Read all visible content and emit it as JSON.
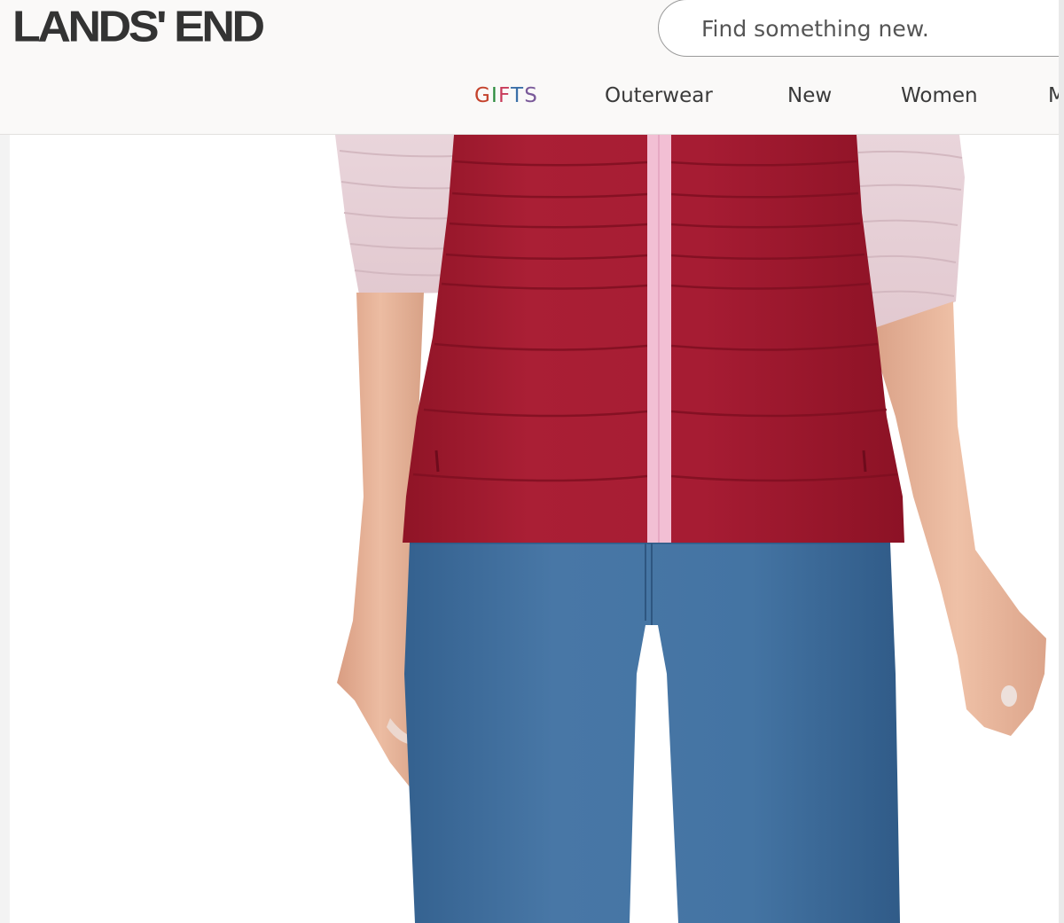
{
  "brand": {
    "logo_text": "LANDS' END",
    "color": "#333333"
  },
  "search": {
    "placeholder": "Find something new."
  },
  "nav": {
    "items": [
      {
        "label": "GIFTS",
        "colors": [
          "#c4422c",
          "#2a8a3c",
          "#c83b5a",
          "#3a6fa8",
          "#7a5a9a"
        ]
      },
      {
        "label": "Outerwear"
      },
      {
        "label": "New"
      },
      {
        "label": "Women"
      },
      {
        "label": "M"
      }
    ]
  },
  "product": {
    "image_icon": "product-photo",
    "colors": {
      "vest": "#a31d32",
      "zipper": "#f0b8d0",
      "sweater": "#e6cfd6",
      "jeans": "#3e6e9e",
      "skin": "#e7b59a"
    }
  }
}
